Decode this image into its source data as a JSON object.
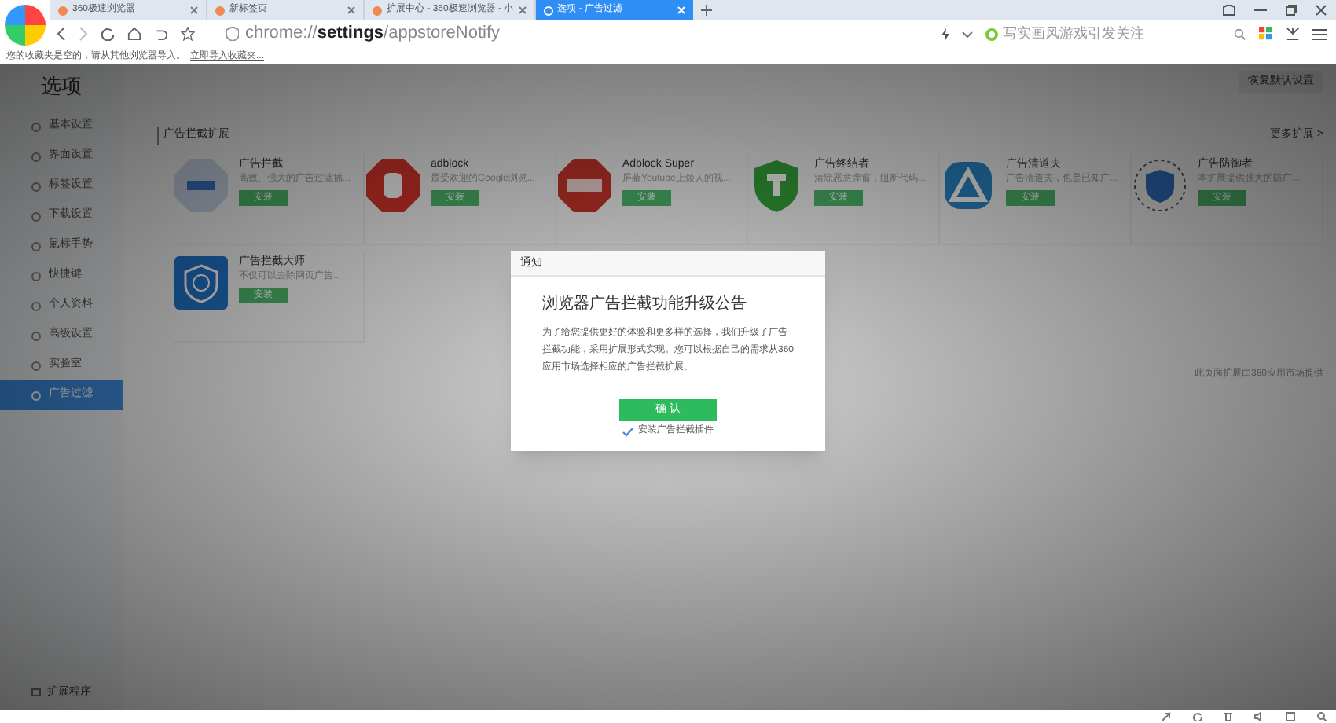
{
  "tabs": [
    {
      "label": "360极速浏览器",
      "selected": false
    },
    {
      "label": "新标签页",
      "selected": false
    },
    {
      "label": "扩展中心 - 360极速浏览器 - 小",
      "selected": false
    },
    {
      "label": "选项 - 广告过滤",
      "selected": true
    }
  ],
  "address": {
    "scheme": "chrome://",
    "host": "settings",
    "path": "/appstoreNotify"
  },
  "search": {
    "placeholder": "写实画风游戏引发关注"
  },
  "bookmarks_bar": {
    "message": "您的收藏夹是空的，请从其他浏览器导入。",
    "link": "立即导入收藏夹..."
  },
  "page": {
    "title": "选项",
    "restore_button": "恢复默认设置",
    "section_title": "广告拦截扩展",
    "more_link": "更多扩展 >",
    "footnote": "此页面扩展由360应用市场提供"
  },
  "sidebar": {
    "items": [
      {
        "label": "基本设置",
        "selected": false
      },
      {
        "label": "界面设置",
        "selected": false
      },
      {
        "label": "标签设置",
        "selected": false
      },
      {
        "label": "下载设置",
        "selected": false
      },
      {
        "label": "鼠标手势",
        "selected": false
      },
      {
        "label": "快捷键",
        "selected": false
      },
      {
        "label": "个人资料",
        "selected": false
      },
      {
        "label": "高级设置",
        "selected": false
      },
      {
        "label": "实验室",
        "selected": false
      },
      {
        "label": "广告过滤",
        "selected": true
      }
    ],
    "footer": "扩展程序"
  },
  "extensions": [
    {
      "name": "广告拦截",
      "description": "高效、强大的广告过滤插...",
      "button": "安装"
    },
    {
      "name": "adblock",
      "description": "最受欢迎的Google浏览...",
      "button": "安装"
    },
    {
      "name": "Adblock Super",
      "description": "屏蔽Youtube上烦人的视...",
      "button": "安装"
    },
    {
      "name": "广告终结者",
      "description": "清除恶意弹窗，阻断代码...",
      "button": "安装"
    },
    {
      "name": "广告清道夫",
      "description": "广告清道夫，也是已知广...",
      "button": "安装"
    },
    {
      "name": "广告防御者",
      "description": "本扩展提供强大的防广...",
      "button": "安装"
    },
    {
      "name": "广告拦截大师",
      "description": "不仅可以去除网页广告...",
      "button": "安装"
    }
  ],
  "dialog": {
    "title": "通知",
    "heading": "浏览器广告拦截功能升级公告",
    "body": "为了给您提供更好的体验和更多样的选择，我们升级了广告拦截功能，采用扩展形式实现。您可以根据自己的需求从360应用市场选择相应的广告拦截扩展。",
    "confirm": "确 认",
    "checkbox": {
      "label": "安装广告拦截插件",
      "checked": true
    }
  }
}
